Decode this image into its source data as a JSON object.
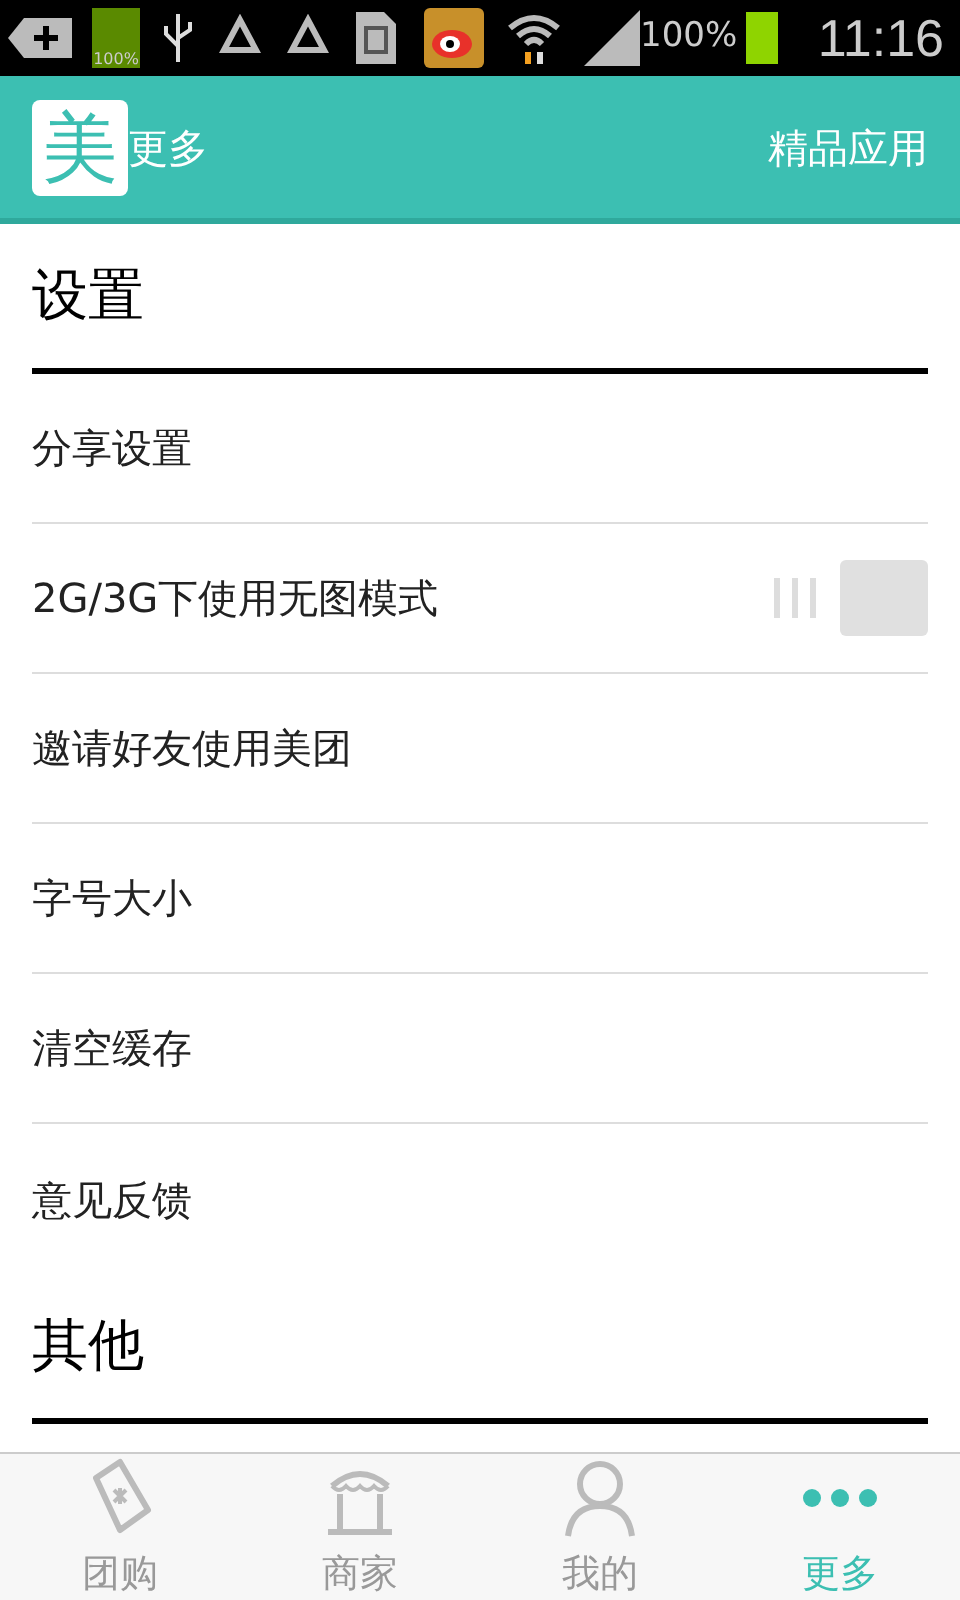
{
  "status_bar": {
    "battery_badge": "100%",
    "battery": "100%",
    "time": "11:16"
  },
  "header": {
    "logo": "美",
    "title": "更多",
    "action": "精品应用"
  },
  "sections": [
    {
      "title": "设置",
      "items": [
        {
          "kind": "link",
          "label": "分享设置"
        },
        {
          "kind": "toggle",
          "label": "2G/3G下使用无图模式",
          "on": false
        },
        {
          "kind": "link",
          "label": "邀请好友使用美团"
        },
        {
          "kind": "link",
          "label": "字号大小"
        },
        {
          "kind": "link",
          "label": "清空缓存"
        },
        {
          "kind": "link",
          "label": "意见反馈"
        }
      ]
    },
    {
      "title": "其他"
    }
  ],
  "tabs": [
    {
      "kind": "tag",
      "label": "团购",
      "selected": false
    },
    {
      "kind": "shop",
      "label": "商家",
      "selected": false
    },
    {
      "kind": "person",
      "label": "我的",
      "selected": false
    },
    {
      "kind": "more",
      "label": "更多",
      "selected": true
    }
  ]
}
